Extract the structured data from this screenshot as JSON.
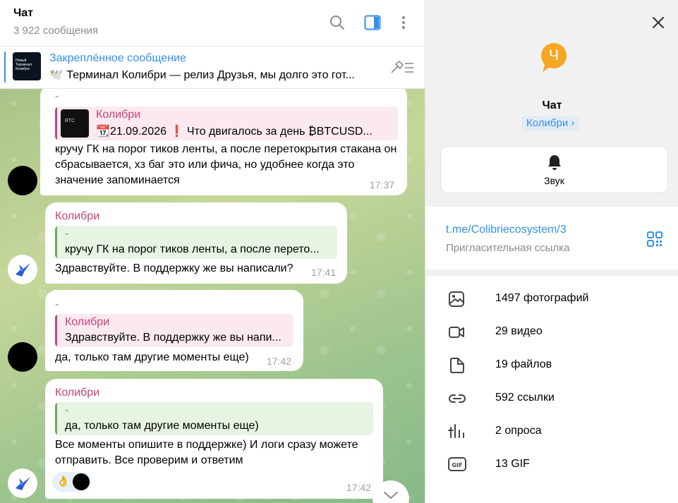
{
  "header": {
    "title": "Чат",
    "subtitle": "3 922 сообщения"
  },
  "pinned": {
    "title": "Закреплённое сообщение",
    "text": "🕊️ Терминал Колибри — релиз Друзья, мы долго это гот...",
    "thumb_text": "Новый Терминал Колибри"
  },
  "messages": [
    {
      "dash": "-",
      "reply_name": "Колибри",
      "reply_text": "📆21.09.2026 ❗ Что двигалось за день ₿BTCUSD...",
      "reply_thumb": "BTC",
      "text": "кручу ГК на порог тиков ленты, а после перетокрытия стакана он сбрасывается, хз баг это или фича, но удобнее когда это значение запоминается",
      "time": "17:37"
    },
    {
      "name": "Колибри",
      "reply_dash": "-",
      "reply_text": "кручу ГК на порог тиков ленты, а после перето...",
      "text": "Здравствуйте. В поддержку же вы написали?",
      "time": "17:41"
    },
    {
      "dash": "-",
      "reply_name": "Колибри",
      "reply_text": "Здравствуйте. В поддержку же вы напи...",
      "text": "да, только там другие моменты еще)",
      "time": "17:42"
    },
    {
      "name": "Колибри",
      "reply_dash": "-",
      "reply_text": "да, только там другие моменты еще)",
      "text": "Все моменты опишите в поддержке) И логи сразу можете отправить. Все проверим и ответим",
      "reaction": "👌",
      "time": "17:42"
    }
  ],
  "info": {
    "avatar_letter": "Ч",
    "name": "Чат",
    "badge": "Колибри ›",
    "sound_label": "Звук",
    "link_url": "t.me/Colibriecosystem/3",
    "link_desc": "Пригласительная ссылка",
    "media": [
      {
        "icon": "photo-icon",
        "label": "1497 фотографий"
      },
      {
        "icon": "video-icon",
        "label": "29 видео"
      },
      {
        "icon": "file-icon",
        "label": "19 файлов"
      },
      {
        "icon": "link-icon",
        "label": "592 ссылки"
      },
      {
        "icon": "poll-icon",
        "label": "2 опроса"
      },
      {
        "icon": "gif-icon",
        "label": "13 GIF"
      }
    ]
  },
  "colors": {
    "accent": "#3390ec",
    "name_pink": "#c9417c",
    "reply_green": "#5fb154",
    "avatar_orange": "#f5a623"
  }
}
